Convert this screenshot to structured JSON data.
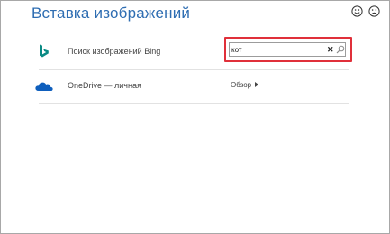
{
  "dialog": {
    "title": "Вставка изображений"
  },
  "feedback": {
    "happy_icon": "smiley-happy-icon",
    "sad_icon": "smiley-sad-icon"
  },
  "sources": {
    "bing": {
      "icon": "bing-logo-icon",
      "label": "Поиск изображений Bing",
      "search_value": "кот",
      "clear_glyph": "✕",
      "search_icon": "search-icon"
    },
    "onedrive": {
      "icon": "onedrive-cloud-icon",
      "label": "OneDrive — личная",
      "browse_label": "Обзор"
    }
  },
  "colors": {
    "title": "#2e6db2",
    "bing": "#0a8a84",
    "onedrive": "#0f5fbd",
    "highlight": "#e0303a"
  }
}
